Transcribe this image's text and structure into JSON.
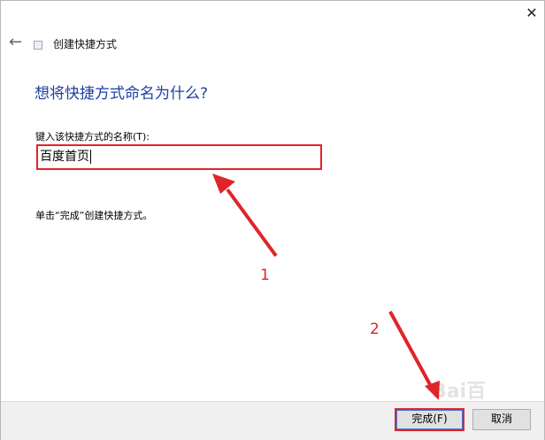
{
  "window": {
    "close_glyph": "✕",
    "back_glyph": "←",
    "title": "创建快捷方式"
  },
  "page": {
    "heading": "想将快捷方式命名为什么?",
    "field_label": "键入该快捷方式的名称(T):",
    "name_value": "百度首页",
    "hint": "单击“完成”创建快捷方式。"
  },
  "buttons": {
    "finish": "完成(F)",
    "cancel": "取消"
  },
  "annotations": {
    "label_1": "1",
    "label_2": "2",
    "color": "#e0242b"
  },
  "watermark": "Bai百"
}
